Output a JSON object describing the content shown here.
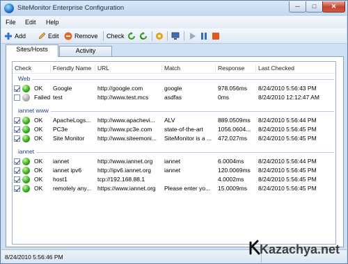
{
  "window": {
    "title": "SiteMonitor Enterprise Configuration",
    "min": "─",
    "max": "□",
    "close": "✕"
  },
  "menu": [
    "File",
    "Edit",
    "Help"
  ],
  "toolbar": {
    "add": "Add",
    "edit": "Edit",
    "remove": "Remove",
    "check": "Check"
  },
  "tabs": [
    "Sites/Hosts",
    "Activity"
  ],
  "columns": [
    "Check",
    "Friendly Name",
    "URL",
    "Match",
    "Response",
    "Last Checked"
  ],
  "groups": [
    {
      "name": "Web",
      "rows": [
        {
          "checked": true,
          "status": "OK",
          "status_color": "green",
          "name": "Google",
          "url": "http://google.com",
          "match": "google",
          "response": "978.056ms",
          "last": "8/24/2010 5:56:43 PM"
        },
        {
          "checked": false,
          "status": "Failed",
          "status_color": "gray",
          "name": "test",
          "url": "http://www.test.mcs",
          "match": "asdfas",
          "response": "0ms",
          "last": "8/24/2010 12:12:47 AM"
        }
      ]
    },
    {
      "name": "iannet www",
      "rows": [
        {
          "checked": true,
          "status": "OK",
          "status_color": "green",
          "name": "ApacheLogs...",
          "url": "http://www.apachevi...",
          "match": "ALV",
          "response": "889.0509ms",
          "last": "8/24/2010 5:56:44 PM"
        },
        {
          "checked": true,
          "status": "OK",
          "status_color": "green",
          "name": "PC3e",
          "url": "http://www.pc3e.com",
          "match": "state-of-the-art",
          "response": "1056.0604...",
          "last": "8/24/2010 5:56:45 PM"
        },
        {
          "checked": true,
          "status": "OK",
          "status_color": "green",
          "name": "Site Monitor",
          "url": "http://www.siteemoni...",
          "match": "SiteMonitor is a ...",
          "response": "472.027ms",
          "last": "8/24/2010 5:56:45 PM"
        }
      ]
    },
    {
      "name": "iannet",
      "rows": [
        {
          "checked": true,
          "status": "OK",
          "status_color": "green",
          "name": "iannet",
          "url": "http://www.iannet.org",
          "match": "iannet",
          "response": "6.0004ms",
          "last": "8/24/2010 5:56:44 PM"
        },
        {
          "checked": true,
          "status": "OK",
          "status_color": "green",
          "name": "iannet ipv6",
          "url": "http://ipv6.iannet.org",
          "match": "iannet",
          "response": "120.0069ms",
          "last": "8/24/2010 5:56:45 PM"
        },
        {
          "checked": true,
          "status": "OK",
          "status_color": "green",
          "name": "host1",
          "url": "tcp://192.168.88.1",
          "match": "",
          "response": "4.0002ms",
          "last": "8/24/2010 5:56:45 PM"
        },
        {
          "checked": true,
          "status": "OK",
          "status_color": "green",
          "name": "remotely any...",
          "url": "https://www.iannet.org",
          "match": "Please enter yo...",
          "response": "15.0009ms",
          "last": "8/24/2010 5:56:45 PM"
        }
      ]
    }
  ],
  "statusbar": {
    "text": "8/24/2010 5:56:46 PM"
  },
  "watermark": "Kazachya.net"
}
